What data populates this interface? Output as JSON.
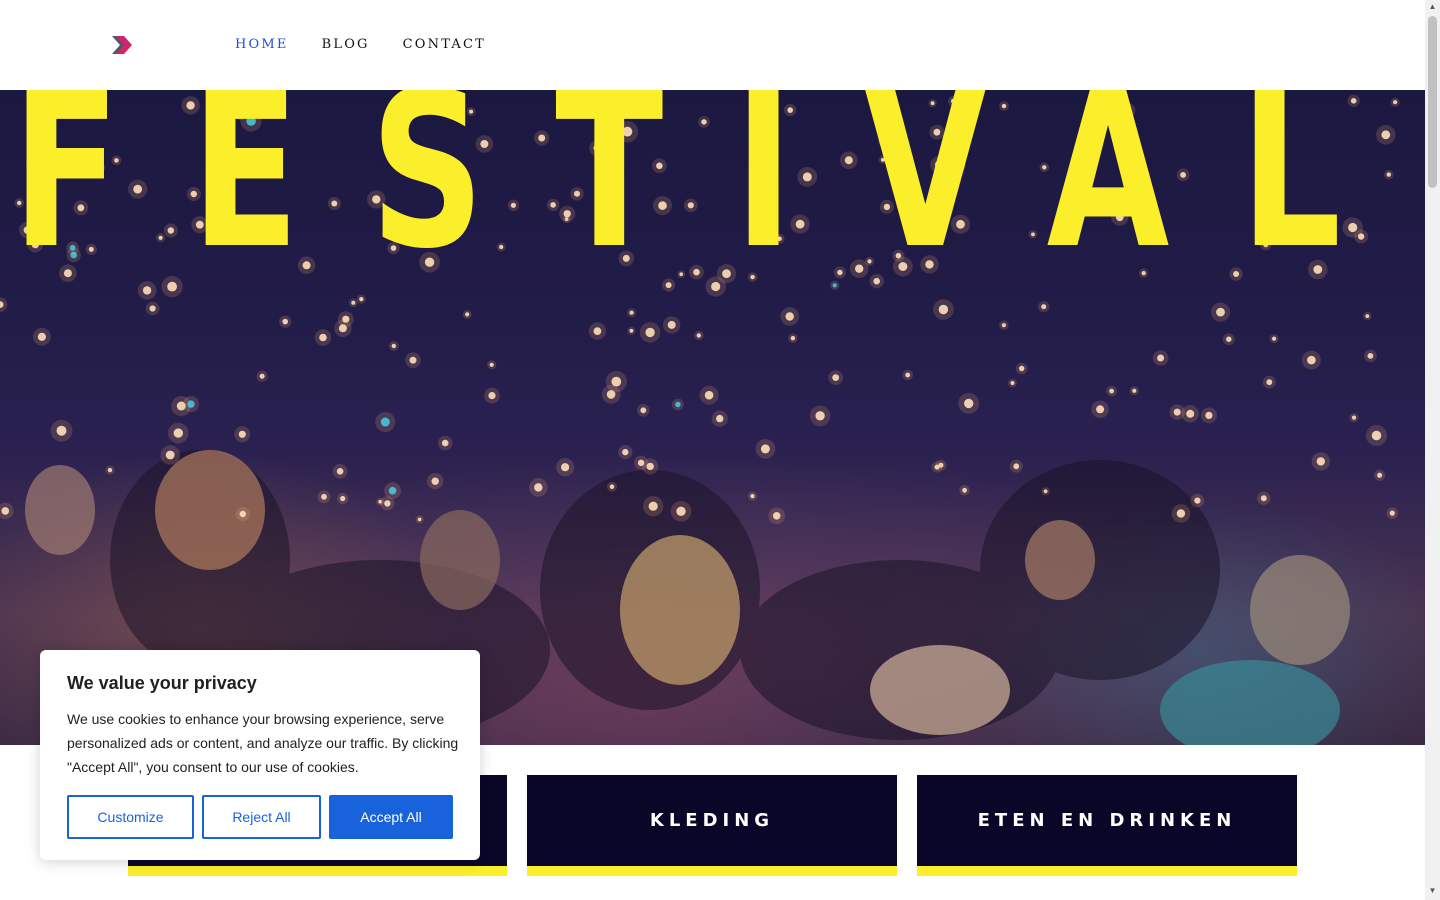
{
  "header": {
    "logo_icon": "chevron-right-logo-icon",
    "nav": [
      {
        "label": "HOME",
        "active": true
      },
      {
        "label": "BLOG",
        "active": false
      },
      {
        "label": "CONTACT",
        "active": false
      }
    ],
    "accent_color": "#1f4fd6"
  },
  "hero": {
    "headline": "FESTIVAL",
    "headline_color": "#fbee2b",
    "image_description_icon": "concert-crowd-image"
  },
  "tiles": [
    {
      "label": ""
    },
    {
      "label": "KLEDING"
    },
    {
      "label": "ETEN EN DRINKEN"
    }
  ],
  "tile_colors": {
    "background": "#0a0628",
    "underline": "#fbee2b"
  },
  "cookie_banner": {
    "title": "We value your privacy",
    "text": "We use cookies to enhance your browsing experience, serve personalized ads or content, and analyze our traffic. By clicking \"Accept All\", you consent to our use of cookies.",
    "buttons": {
      "customize": "Customize",
      "reject": "Reject All",
      "accept": "Accept All"
    },
    "accent_color": "#1863dc"
  }
}
